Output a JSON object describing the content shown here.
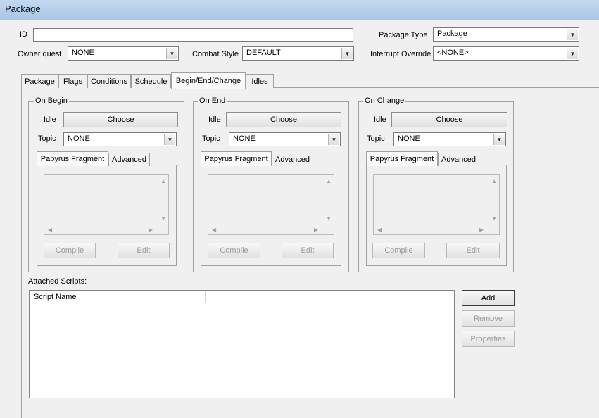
{
  "window": {
    "title": "Package"
  },
  "form": {
    "id_label": "ID",
    "id_value": "",
    "package_type_label": "Package Type",
    "package_type_value": "Package",
    "owner_quest_label": "Owner quest",
    "owner_quest_value": "NONE",
    "combat_style_label": "Combat Style",
    "combat_style_value": "DEFAULT",
    "interrupt_override_label": "Interrupt Override",
    "interrupt_override_value": "<NONE>"
  },
  "tabs": [
    "Package",
    "Flags",
    "Conditions",
    "Schedule",
    "Begin/End/Change",
    "Idles"
  ],
  "active_tab": "Begin/End/Change",
  "groups": [
    {
      "title": "On Begin",
      "idle_label": "Idle",
      "choose_label": "Choose",
      "topic_label": "Topic",
      "topic_value": "NONE",
      "subtabs": [
        "Papyrus Fragment",
        "Advanced"
      ],
      "compile_label": "Compile",
      "edit_label": "Edit"
    },
    {
      "title": "On End",
      "idle_label": "Idle",
      "choose_label": "Choose",
      "topic_label": "Topic",
      "topic_value": "NONE",
      "subtabs": [
        "Papyrus Fragment",
        "Advanced"
      ],
      "compile_label": "Compile",
      "edit_label": "Edit"
    },
    {
      "title": "On Change",
      "idle_label": "Idle",
      "choose_label": "Choose",
      "topic_label": "Topic",
      "topic_value": "NONE",
      "subtabs": [
        "Papyrus Fragment",
        "Advanced"
      ],
      "compile_label": "Compile",
      "edit_label": "Edit"
    }
  ],
  "scripts": {
    "label": "Attached Scripts:",
    "column_header": "Script Name",
    "add_label": "Add",
    "remove_label": "Remove",
    "properties_label": "Properties"
  }
}
